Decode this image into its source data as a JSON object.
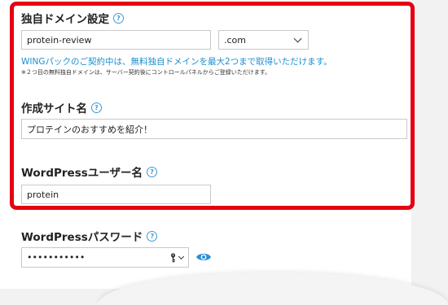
{
  "domain_section": {
    "label": "独自ドメイン設定",
    "help": "?",
    "domain_input": {
      "value": "protein-review"
    },
    "tld_select": {
      "selected": ".com"
    },
    "notice": "WINGパックのご契約中は、無料独自ドメインを最大2つまで取得いただけます。",
    "subnote": "※２つ目の無料独自ドメインは、サーバー契約後にコントロールパネルからご登録いただけます。"
  },
  "site_name_section": {
    "label": "作成サイト名",
    "help": "?",
    "input": {
      "value": "プロテインのおすすめを紹介！"
    }
  },
  "wp_user_section": {
    "label": "WordPressユーザー名",
    "help": "?",
    "input": {
      "value": "protein"
    }
  },
  "wp_password_section": {
    "label": "WordPressパスワード",
    "help": "?",
    "input": {
      "value": "•••••••••••"
    }
  },
  "colors": {
    "highlight_border": "#e50012",
    "help_icon": "#3b9ad8",
    "notice_text": "#1a8fd0",
    "eye_icon": "#2a8fd6"
  }
}
